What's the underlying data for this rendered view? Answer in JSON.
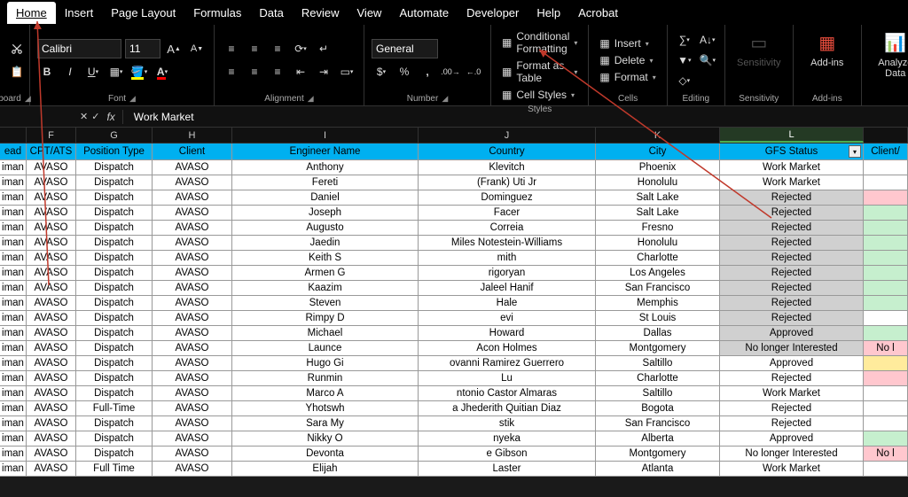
{
  "menu": [
    "Home",
    "Insert",
    "Page Layout",
    "Formulas",
    "Data",
    "Review",
    "View",
    "Automate",
    "Developer",
    "Help",
    "Acrobat"
  ],
  "ribbon": {
    "clipboard_label": "board",
    "font": {
      "name": "Calibri",
      "size": "11",
      "label": "Font"
    },
    "alignment_label": "Alignment",
    "number": {
      "format": "General",
      "label": "Number"
    },
    "styles": {
      "conditional": "Conditional Formatting",
      "table": "Format as Table",
      "cell": "Cell Styles",
      "label": "Styles"
    },
    "cells": {
      "insert": "Insert",
      "delete": "Delete",
      "format": "Format",
      "label": "Cells"
    },
    "editing_label": "Editing",
    "sensitivity": {
      "btn": "Sensitivity",
      "label": "Sensitivity"
    },
    "addins": {
      "btn": "Add-ins",
      "label": "Add-ins"
    },
    "analyze": {
      "btn": "Analyze Data"
    }
  },
  "formula_value": "Work Market",
  "col_letters": [
    "",
    "F",
    "G",
    "H",
    "I",
    "J",
    "K",
    "L",
    ""
  ],
  "headers": {
    "ead": "ead",
    "cpt": "CPT/ATS",
    "pos": "Position Type",
    "cli": "Client",
    "eng": "Engineer Name",
    "cou": "Country",
    "cit": "City",
    "gfs": "GFS Status",
    "last": "Client/"
  },
  "rows": [
    {
      "ead": "iman",
      "cpt": "AVASO",
      "pos": "Dispatch",
      "cli": "AVASO",
      "eng": "Anthony",
      "cou": "Klevitch",
      "cit": "Phoenix",
      "gfs": "Work Market",
      "gfs_c": "",
      "last": "",
      "last_c": ""
    },
    {
      "ead": "iman",
      "cpt": "AVASO",
      "pos": "Dispatch",
      "cli": "AVASO",
      "eng": "Fereti",
      "cou": "(Frank) Uti Jr",
      "cit": "Honolulu",
      "gfs": "Work Market",
      "gfs_c": "",
      "last": "",
      "last_c": ""
    },
    {
      "ead": "iman",
      "cpt": "AVASO",
      "pos": "Dispatch",
      "cli": "AVASO",
      "eng": "Daniel",
      "cou": "Dominguez",
      "cit": "Salt Lake",
      "gfs": "Rejected",
      "gfs_c": "gray",
      "last": "",
      "last_c": "pink"
    },
    {
      "ead": "iman",
      "cpt": "AVASO",
      "pos": "Dispatch",
      "cli": "AVASO",
      "eng": "Joseph",
      "cou": "Facer",
      "cit": "Salt Lake",
      "gfs": "Rejected",
      "gfs_c": "gray",
      "last": "",
      "last_c": "green"
    },
    {
      "ead": "iman",
      "cpt": "AVASO",
      "pos": "Dispatch",
      "cli": "AVASO",
      "eng": "Augusto",
      "cou": "Correia",
      "cit": "Fresno",
      "gfs": "Rejected",
      "gfs_c": "gray",
      "last": "",
      "last_c": "green"
    },
    {
      "ead": "iman",
      "cpt": "AVASO",
      "pos": "Dispatch",
      "cli": "AVASO",
      "eng": "Jaedin",
      "cou": "Miles Notestein-Williams",
      "cit": "Honolulu",
      "gfs": "Rejected",
      "gfs_c": "gray",
      "last": "",
      "last_c": "green"
    },
    {
      "ead": "iman",
      "cpt": "AVASO",
      "pos": "Dispatch",
      "cli": "AVASO",
      "eng": "Keith S",
      "cou": "mith",
      "cit": "Charlotte",
      "gfs": "Rejected",
      "gfs_c": "gray",
      "last": "",
      "last_c": "green"
    },
    {
      "ead": "iman",
      "cpt": "AVASO",
      "pos": "Dispatch",
      "cli": "AVASO",
      "eng": "Armen G",
      "cou": "rigoryan",
      "cit": "Los Angeles",
      "gfs": "Rejected",
      "gfs_c": "gray",
      "last": "",
      "last_c": "green"
    },
    {
      "ead": "iman",
      "cpt": "AVASO",
      "pos": "Dispatch",
      "cli": "AVASO",
      "eng": "Kaazim",
      "cou": "Jaleel Hanif",
      "cit": "San Francisco",
      "gfs": "Rejected",
      "gfs_c": "gray",
      "last": "",
      "last_c": "green"
    },
    {
      "ead": "iman",
      "cpt": "AVASO",
      "pos": "Dispatch",
      "cli": "AVASO",
      "eng": "Steven",
      "cou": "Hale",
      "cit": "Memphis",
      "gfs": "Rejected",
      "gfs_c": "gray",
      "last": "",
      "last_c": "green"
    },
    {
      "ead": "iman",
      "cpt": "AVASO",
      "pos": "Dispatch",
      "cli": "AVASO",
      "eng": "Rimpy D",
      "cou": "evi",
      "cit": "St Louis",
      "gfs": "Rejected",
      "gfs_c": "gray",
      "last": "",
      "last_c": ""
    },
    {
      "ead": "iman",
      "cpt": "AVASO",
      "pos": "Dispatch",
      "cli": "AVASO",
      "eng": "Michael",
      "cou": "Howard",
      "cit": "Dallas",
      "gfs": "Approved",
      "gfs_c": "gray",
      "last": "",
      "last_c": "green"
    },
    {
      "ead": "iman",
      "cpt": "AVASO",
      "pos": "Dispatch",
      "cli": "AVASO",
      "eng": "Launce",
      "cou": "Acon Holmes",
      "cit": "Montgomery",
      "gfs": "No longer Interested",
      "gfs_c": "gray",
      "last": "No l",
      "last_c": "pink"
    },
    {
      "ead": "iman",
      "cpt": "AVASO",
      "pos": "Dispatch",
      "cli": "AVASO",
      "eng": "Hugo Gi",
      "cou": "ovanni Ramirez Guerrero",
      "cit": "Saltillo",
      "gfs": "Approved",
      "gfs_c": "",
      "last": "",
      "last_c": "orange"
    },
    {
      "ead": "iman",
      "cpt": "AVASO",
      "pos": "Dispatch",
      "cli": "AVASO",
      "eng": "Runmin",
      "cou": "Lu",
      "cit": "Charlotte",
      "gfs": "Rejected",
      "gfs_c": "",
      "last": "",
      "last_c": "pink"
    },
    {
      "ead": "iman",
      "cpt": "AVASO",
      "pos": "Dispatch",
      "cli": "AVASO",
      "eng": "Marco A",
      "cou": "ntonio Castor Almaras",
      "cit": "Saltillo",
      "gfs": "Work Market",
      "gfs_c": "",
      "last": "",
      "last_c": ""
    },
    {
      "ead": "iman",
      "cpt": "AVASO",
      "pos": "Full-Time",
      "cli": "AVASO",
      "eng": "Yhotswh",
      "cou": "a Jhederith Quitian Diaz",
      "cit": "Bogota",
      "gfs": "Rejected",
      "gfs_c": "",
      "last": "",
      "last_c": ""
    },
    {
      "ead": "iman",
      "cpt": "AVASO",
      "pos": "Dispatch",
      "cli": "AVASO",
      "eng": "Sara My",
      "cou": "stik",
      "cit": "San Francisco",
      "gfs": "Rejected",
      "gfs_c": "",
      "last": "",
      "last_c": ""
    },
    {
      "ead": "iman",
      "cpt": "AVASO",
      "pos": "Dispatch",
      "cli": "AVASO",
      "eng": "Nikky O",
      "cou": "nyeka",
      "cit": "Alberta",
      "gfs": "Approved",
      "gfs_c": "",
      "last": "",
      "last_c": "green"
    },
    {
      "ead": "iman",
      "cpt": "AVASO",
      "pos": "Dispatch",
      "cli": "AVASO",
      "eng": "Devonta",
      "cou": "e Gibson",
      "cit": "Montgomery",
      "gfs": "No longer Interested",
      "gfs_c": "",
      "last": "No l",
      "last_c": "pink"
    },
    {
      "ead": "iman",
      "cpt": "AVASO",
      "pos": "Full Time",
      "cli": "AVASO",
      "eng": "Elijah",
      "cou": "Laster",
      "cit": "Atlanta",
      "gfs": "Work Market",
      "gfs_c": "",
      "last": "",
      "last_c": ""
    }
  ]
}
